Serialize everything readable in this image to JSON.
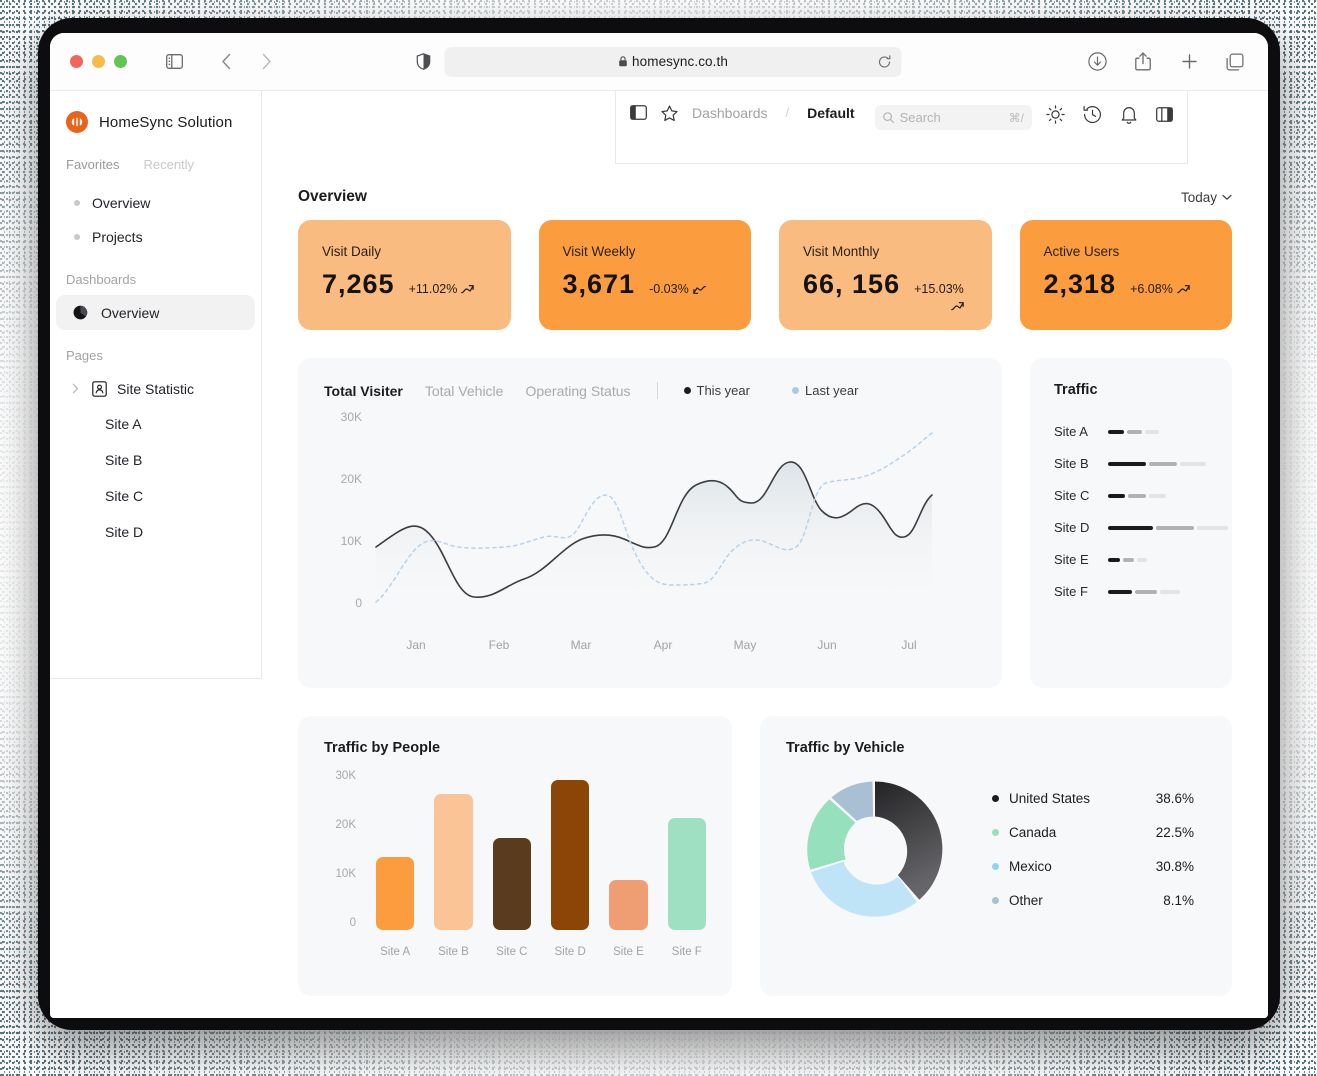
{
  "browser": {
    "url": "homesync.co.th",
    "icons": {
      "sidebar_toggle": "sidebar-toggle-icon",
      "back": "back-chevron-icon",
      "forward": "forward-chevron-icon",
      "shield": "shield-icon",
      "lock": "lock-icon",
      "reload": "reload-icon",
      "download": "download-icon",
      "share": "share-icon",
      "new_tab": "plus-icon",
      "tabs": "tab-overview-icon"
    }
  },
  "sidebar": {
    "brand": "HomeSync Solution",
    "tabs": {
      "favorites": "Favorites",
      "recently": "Recently"
    },
    "favorites": [
      {
        "label": "Overview"
      },
      {
        "label": "Projects"
      }
    ],
    "dashboards_label": "Dashboards",
    "dashboards": [
      {
        "label": "Overview",
        "active": true
      }
    ],
    "pages_label": "Pages",
    "pages_parent": "Site Statistic",
    "pages": [
      {
        "label": "Site A"
      },
      {
        "label": "Site B"
      },
      {
        "label": "Site C"
      },
      {
        "label": "Site D"
      }
    ]
  },
  "app_header": {
    "breadcrumb_root": "Dashboards",
    "breadcrumb_sep": "/",
    "breadcrumb_current": "Default",
    "search_placeholder": "Search",
    "search_shortcut": "⌘/"
  },
  "page": {
    "title": "Overview",
    "range": "Today"
  },
  "kpis": [
    {
      "label": "Visit Daily",
      "value": "7,265",
      "delta": "+11.02%",
      "trend": "up",
      "bg": "#fabb81"
    },
    {
      "label": "Visit Weekly",
      "value": "3,671",
      "delta": "-0.03%",
      "trend": "down",
      "bg": "#fb9d3e"
    },
    {
      "label": "Visit Monthly",
      "value": "66, 156",
      "delta": "+15.03%",
      "trend": "up",
      "bg": "#fabb81"
    },
    {
      "label": "Active Users",
      "value": "2,318",
      "delta": "+6.08%",
      "trend": "up",
      "bg": "#fb9d3e"
    }
  ],
  "visiter_card": {
    "tabs": [
      {
        "label": "Total Visiter",
        "active": true
      },
      {
        "label": "Total Vehicle",
        "active": false
      },
      {
        "label": "Operating Status",
        "active": false
      }
    ],
    "legend": [
      {
        "label": "This year",
        "color": "#1d1d1f"
      },
      {
        "label": "Last year",
        "color": "#a9cbe8"
      }
    ]
  },
  "traffic_card": {
    "title": "Traffic",
    "rows": [
      {
        "label": "Site A",
        "segments": [
          16,
          15,
          14
        ]
      },
      {
        "label": "Site B",
        "segments": [
          38,
          28,
          26
        ]
      },
      {
        "label": "Site C",
        "segments": [
          17,
          18,
          17
        ]
      },
      {
        "label": "Site D",
        "segments": [
          45,
          38,
          31
        ]
      },
      {
        "label": "Site E",
        "segments": [
          12,
          11,
          10
        ]
      },
      {
        "label": "Site F",
        "segments": [
          24,
          22,
          20
        ]
      }
    ]
  },
  "people_card": {
    "title": "Traffic by People"
  },
  "vehicle_card": {
    "title": "Traffic by Vehicle"
  },
  "chart_data": [
    {
      "type": "line",
      "title": "Total Visiter",
      "xlabel": "",
      "ylabel": "",
      "x": [
        "Jan",
        "Feb",
        "Mar",
        "Apr",
        "May",
        "Jun",
        "Jul"
      ],
      "ylim": [
        0,
        30000
      ],
      "yticks": [
        "0",
        "10K",
        "20K",
        "30K"
      ],
      "grid": false,
      "legend_position": "top-right",
      "series": [
        {
          "name": "This year",
          "style": "solid",
          "color": "#3c3c40",
          "values": [
            9500,
            3800,
            6200,
            10600,
            10200,
            21000,
            24500,
            17700,
            19500,
            14800,
            19800,
            20100
          ]
        },
        {
          "name": "Last year",
          "style": "dashed",
          "color": "#a9cbe8",
          "values": [
            800,
            9700,
            9300,
            9100,
            17200,
            3100,
            3000,
            10800,
            8900,
            21000,
            22000,
            27200
          ]
        }
      ]
    },
    {
      "type": "bar",
      "title": "Traffic by People",
      "categories": [
        "Site A",
        "Site B",
        "Site C",
        "Site D",
        "Site E",
        "Site F"
      ],
      "values": [
        15000,
        28000,
        19000,
        31000,
        10300,
        23000
      ],
      "colors": [
        "#fb9d3e",
        "#fbc496",
        "#5b3b1d",
        "#8b4507",
        "#ef9d72",
        "#9fe0c3"
      ],
      "ylim": [
        0,
        33000
      ],
      "yticks": [
        "0",
        "10K",
        "20K",
        "30K"
      ],
      "grid": false,
      "xlabel": "",
      "ylabel": ""
    },
    {
      "type": "pie",
      "title": "Traffic by Vehicle",
      "labels": [
        "United States",
        "Canada",
        "Mexico",
        "Other"
      ],
      "values": [
        38.6,
        22.5,
        30.8,
        8.1
      ],
      "value_labels": [
        "38.6%",
        "22.5%",
        "30.8%",
        "8.1%"
      ],
      "colors": [
        "#2c2c2e",
        "#96e0bd",
        "#bfe4f8",
        "#a8bfd4"
      ],
      "legend_position": "right",
      "donut": true
    }
  ]
}
